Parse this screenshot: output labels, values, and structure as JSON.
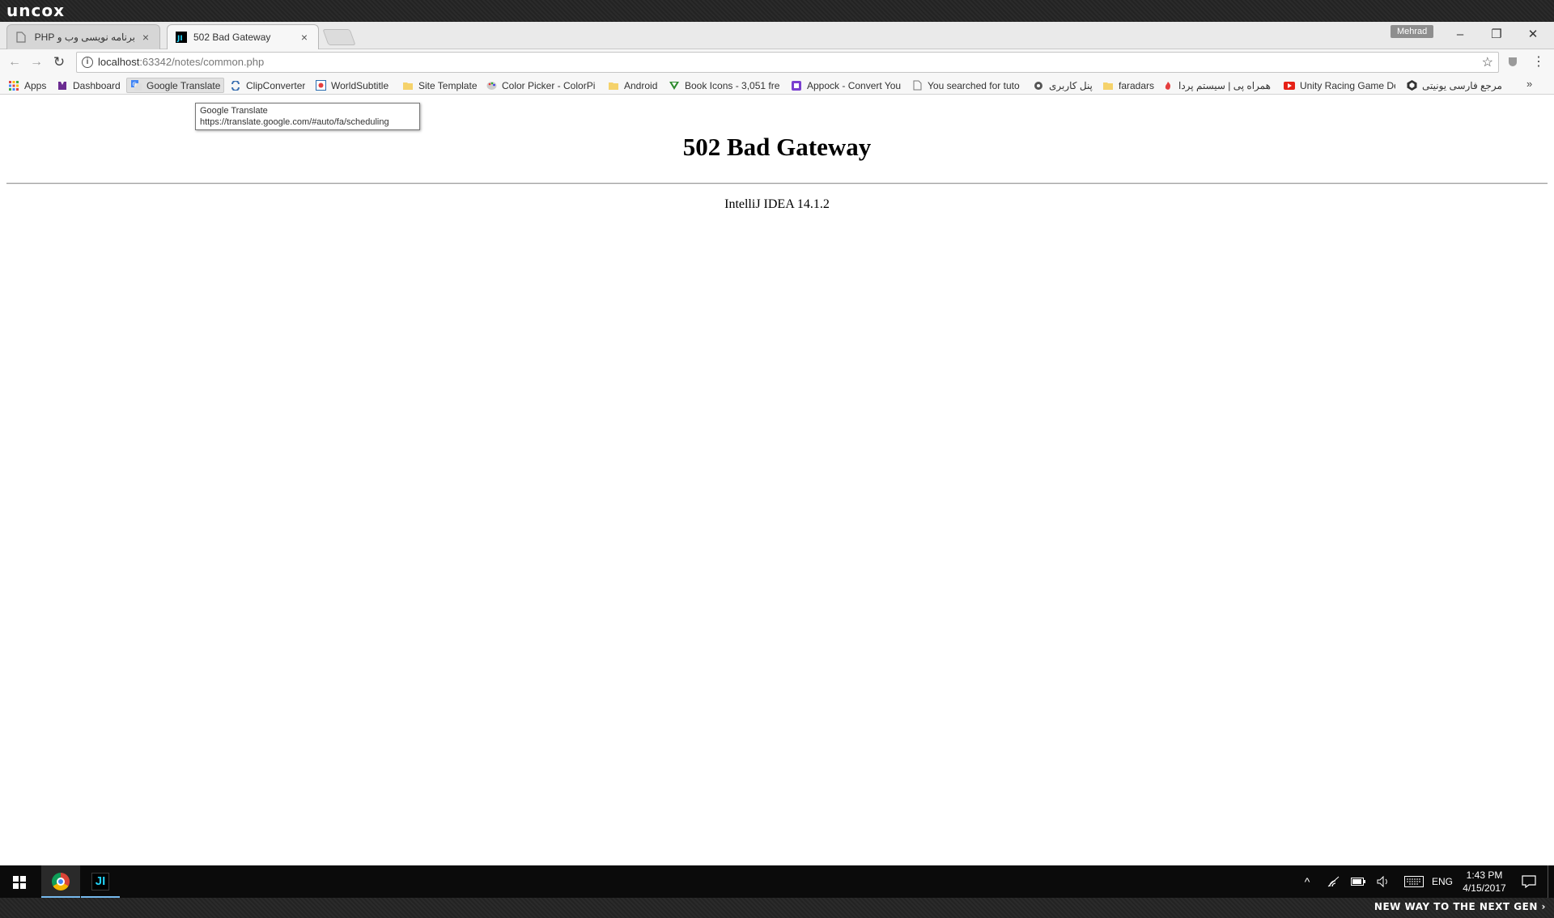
{
  "brand": {
    "logo": "uncox",
    "tagline": "NEW WAY TO THE NEXT GEN ›"
  },
  "tabs": [
    {
      "title": "برنامه نویسی وب و PHP د",
      "icon": "page-icon",
      "close": "×"
    },
    {
      "title": "502 Bad Gateway",
      "icon": "intellij-icon",
      "close": "×"
    }
  ],
  "window": {
    "profile": "Mehrad",
    "minimize": "–",
    "restore": "❐",
    "close": "✕"
  },
  "toolbar": {
    "back": "←",
    "forward": "→",
    "reload": "↻",
    "url_host": "localhost",
    "url_rest": ":63342/notes/common.php",
    "info": "i",
    "star": "☆",
    "menu": "⋮"
  },
  "bookmarks": [
    {
      "label": "Apps",
      "icon": "apps-grid-icon"
    },
    {
      "label": "Dashboard",
      "icon": "dashboard-icon"
    },
    {
      "label": "Google Translate",
      "icon": "translate-icon"
    },
    {
      "label": "ClipConverter",
      "icon": "clipconverter-icon"
    },
    {
      "label": "WorldSubtitle",
      "icon": "worldsubtitle-icon"
    },
    {
      "label": "Site Template",
      "icon": "folder-icon"
    },
    {
      "label": "Color Picker - ColorPi",
      "icon": "palette-icon"
    },
    {
      "label": "Android",
      "icon": "folder-icon"
    },
    {
      "label": "Book Icons - 3,051 fre",
      "icon": "book-icons-icon"
    },
    {
      "label": "Appock - Convert You",
      "icon": "appock-icon"
    },
    {
      "label": "You searched for tuto",
      "icon": "page-icon"
    },
    {
      "label": "پنل کاربری",
      "icon": "gear-icon"
    },
    {
      "label": "faradars",
      "icon": "folder-icon"
    },
    {
      "label": "همراه پی | سیستم پردا",
      "icon": "hamrahpay-icon"
    },
    {
      "label": "Unity Racing Game De",
      "icon": "youtube-icon"
    },
    {
      "label": "مرجع فارسی یونیتی",
      "icon": "unity-icon"
    }
  ],
  "bookmarks_more": "»",
  "tooltip": {
    "title": "Google Translate",
    "url": "https://translate.google.com/#auto/fa/scheduling"
  },
  "page": {
    "heading": "502 Bad Gateway",
    "footer": "IntelliJ IDEA 14.1.2"
  },
  "taskbar": {
    "tray_up": "^",
    "language": "ENG",
    "time": "1:43 PM",
    "date": "4/15/2017",
    "ij_label": "JI"
  },
  "colors": {
    "accent": "#76b9ed",
    "taskbar": "#0b0b0b",
    "page_bg": "#ffffff"
  }
}
